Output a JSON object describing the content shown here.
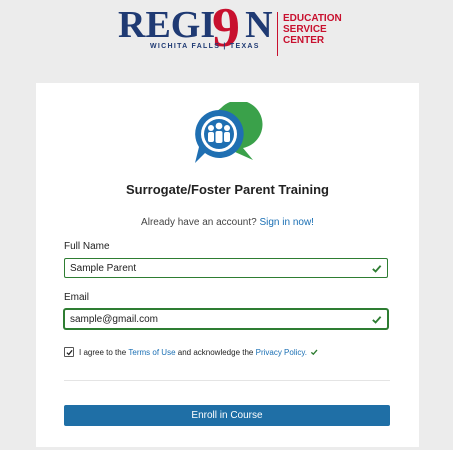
{
  "header": {
    "logo_word_left": "REGI",
    "logo_nine": "9",
    "logo_word_right": "N",
    "logo_sub": "WICHITA FALLS | TEXAS",
    "logo_right_lines": [
      "EDUCATION",
      "SERVICE",
      "CENTER"
    ]
  },
  "card": {
    "title": "Surrogate/Foster Parent Training",
    "signin_prefix": "Already have an account?",
    "signin_link": "Sign in now!",
    "full_name_label": "Full Name",
    "full_name_value": "Sample Parent",
    "email_label": "Email",
    "email_value": "sample@gmail.com",
    "agree_prefix": "I agree to the",
    "terms_link": "Terms of Use",
    "agree_middle": "and acknowledge the",
    "privacy_link": "Privacy Policy.",
    "enroll_button": "Enroll in Course"
  },
  "colors": {
    "brand_blue": "#1f3a73",
    "brand_red": "#c8102e",
    "button_blue": "#1f6fa6",
    "link_blue": "#1a6fb4",
    "valid_green": "#2e7d32"
  },
  "icons": {
    "app_icon": "chat-bubbles-people-icon",
    "valid": "check-icon"
  }
}
